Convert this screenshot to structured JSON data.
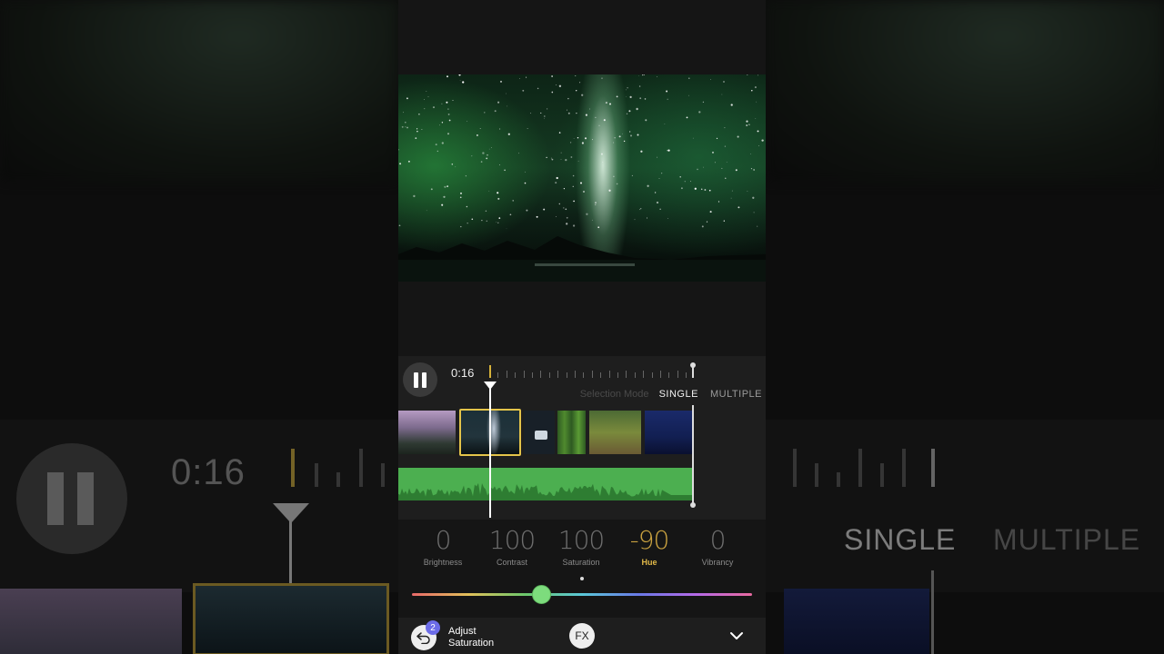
{
  "player": {
    "time": "0:16",
    "selection_mode_label": "Selection Mode",
    "mode_single": "SINGLE",
    "mode_multiple": "MULTIPLE"
  },
  "adjustments": [
    {
      "value": "0",
      "name": "Brightness",
      "active": false
    },
    {
      "value": "100",
      "name": "Contrast",
      "active": false
    },
    {
      "value": "100",
      "name": "Saturation",
      "active": false
    },
    {
      "value": "-90",
      "name": "Hue",
      "active": true
    },
    {
      "value": "0",
      "name": "Vibrancy",
      "active": false
    }
  ],
  "slider": {
    "level": 0.38
  },
  "toolbar": {
    "undo_count": "2",
    "action_line1": "Adjust",
    "action_line2": "Saturation",
    "fx_label": "FX"
  },
  "colors": {
    "accent": "#e4c44a",
    "audio_track": "#4caf50",
    "slider_thumb": "#7ddc7d",
    "badge": "#6c6ce8"
  },
  "icons": {
    "pause": "pause-icon",
    "undo": "undo-icon",
    "chevron": "chevron-down-icon"
  }
}
